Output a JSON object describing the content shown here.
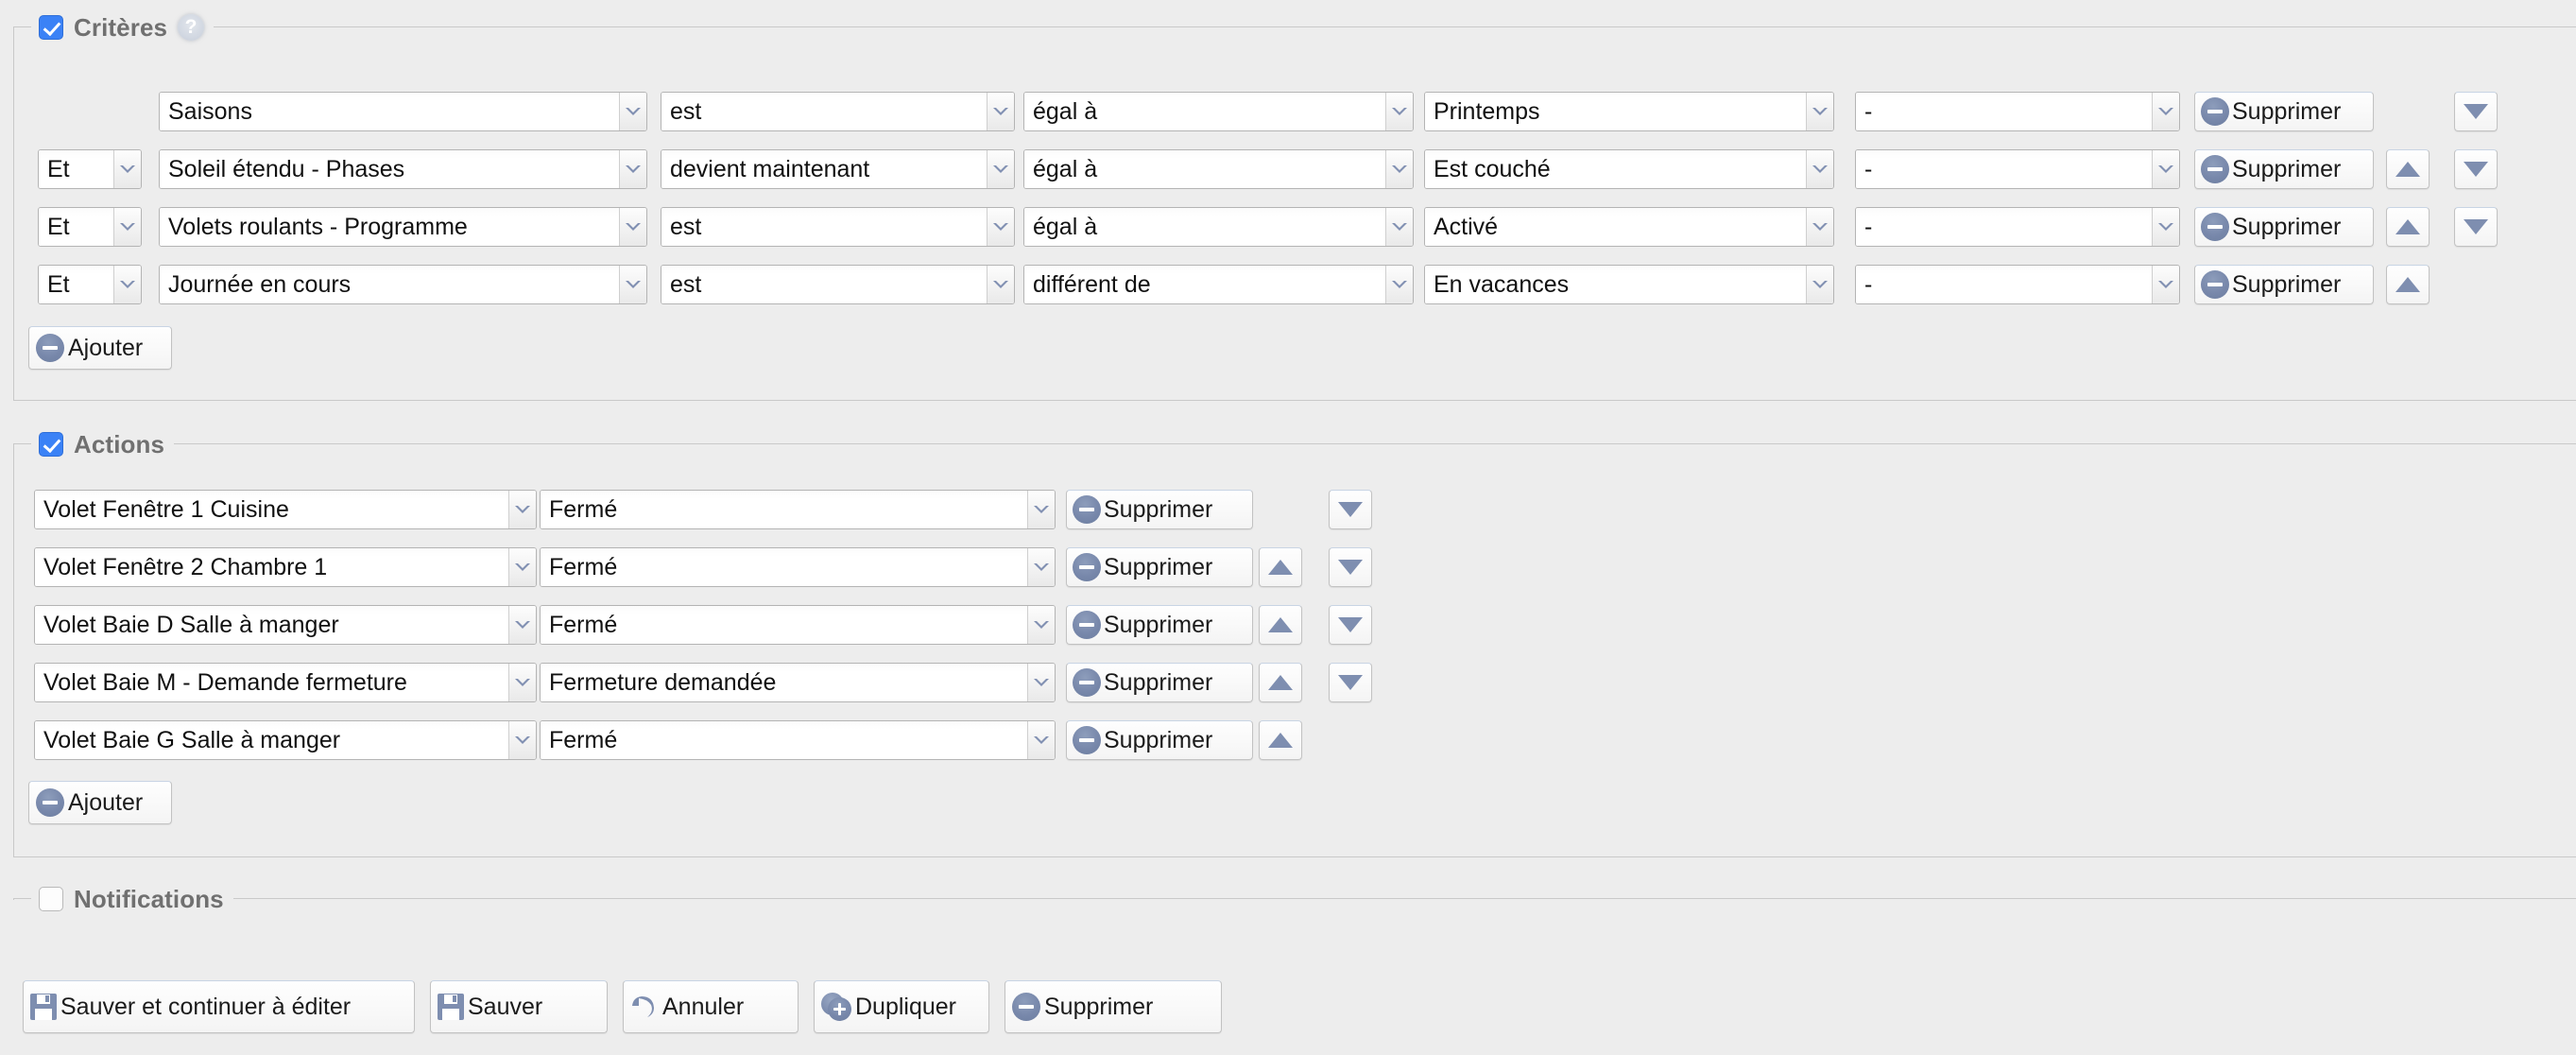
{
  "sections": {
    "criteria": {
      "legend": "Critères",
      "checked": true,
      "help_icon": "help-icon",
      "columns": [
        "logic",
        "subject",
        "event",
        "operator",
        "value",
        "extra"
      ],
      "rows": [
        {
          "logic": "",
          "subject": "Saisons",
          "event": "est",
          "operator": "égal à",
          "value": "Printemps",
          "extra": "-",
          "delete_label": "Supprimer",
          "has_up": false,
          "has_down": true
        },
        {
          "logic": "Et",
          "subject": "Soleil étendu - Phases",
          "event": "devient maintenant",
          "operator": "égal à",
          "value": "Est couché",
          "extra": "-",
          "delete_label": "Supprimer",
          "has_up": true,
          "has_down": true
        },
        {
          "logic": "Et",
          "subject": "Volets roulants - Programme",
          "event": "est",
          "operator": "égal à",
          "value": "Activé",
          "extra": "-",
          "delete_label": "Supprimer",
          "has_up": true,
          "has_down": true
        },
        {
          "logic": "Et",
          "subject": "Journée en cours",
          "event": "est",
          "operator": "différent de",
          "value": "En vacances",
          "extra": "-",
          "delete_label": "Supprimer",
          "has_up": true,
          "has_down": false
        }
      ],
      "add_label": "Ajouter"
    },
    "actions": {
      "legend": "Actions",
      "checked": true,
      "rows": [
        {
          "target": "Volet Fenêtre 1 Cuisine",
          "state": "Fermé",
          "delete_label": "Supprimer",
          "has_up": false,
          "has_down": true
        },
        {
          "target": "Volet Fenêtre 2 Chambre 1",
          "state": "Fermé",
          "delete_label": "Supprimer",
          "has_up": true,
          "has_down": true
        },
        {
          "target": "Volet Baie D Salle à manger",
          "state": "Fermé",
          "delete_label": "Supprimer",
          "has_up": true,
          "has_down": true
        },
        {
          "target": "Volet Baie M - Demande fermeture",
          "state": "Fermeture demandée",
          "delete_label": "Supprimer",
          "has_up": true,
          "has_down": true
        },
        {
          "target": "Volet Baie G Salle à manger",
          "state": "Fermé",
          "delete_label": "Supprimer",
          "has_up": true,
          "has_down": false
        }
      ],
      "add_label": "Ajouter"
    },
    "notifications": {
      "legend": "Notifications",
      "checked": false
    }
  },
  "footer": {
    "buttons": [
      {
        "label": "Sauver et continuer à éditer",
        "icon": "save-icon"
      },
      {
        "label": "Sauver",
        "icon": "save-icon"
      },
      {
        "label": "Annuler",
        "icon": "undo-icon"
      },
      {
        "label": "Dupliquer",
        "icon": "duplicate-icon"
      },
      {
        "label": "Supprimer",
        "icon": "minus-circle-icon"
      }
    ]
  },
  "colors": {
    "background": "#ededed",
    "checkbox_accent": "#3b82f6",
    "icon_blue": "#7e8eb0",
    "legend_text": "#707070",
    "border": "#c9c9c9"
  }
}
